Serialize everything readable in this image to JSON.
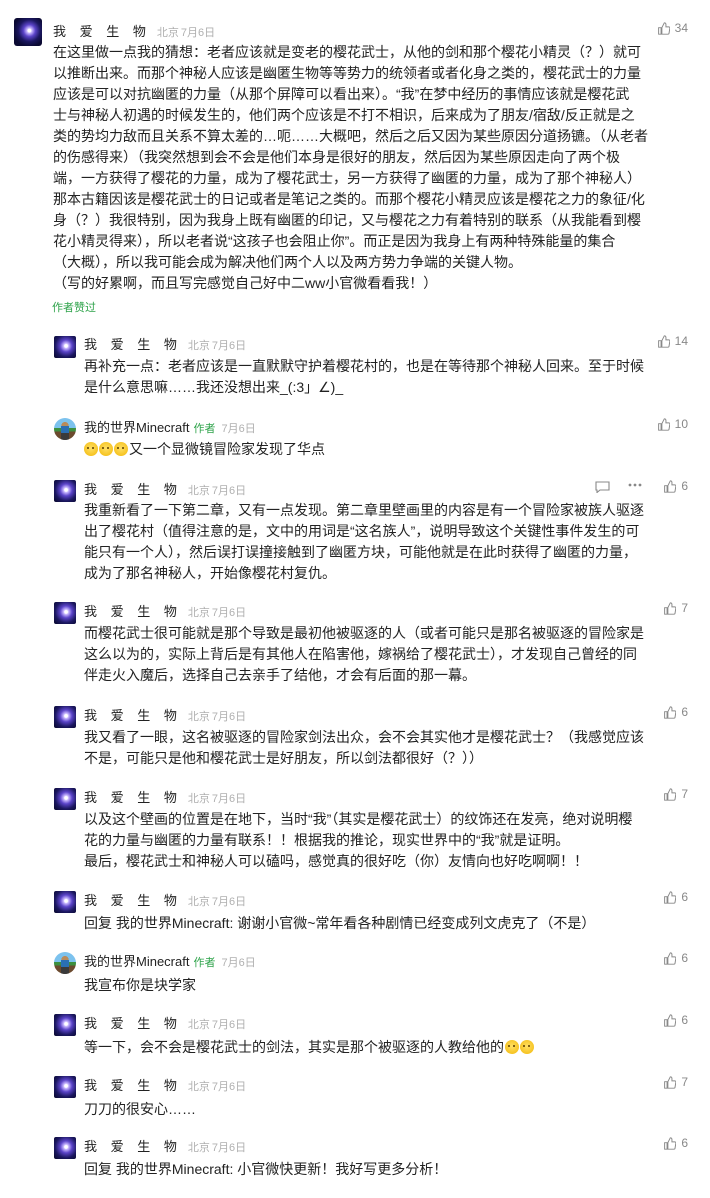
{
  "like_icon": "thumb-up-icon",
  "comments": [
    {
      "user": "我 爱 生 物",
      "location": "北京",
      "date": "7月6日",
      "likes": "34",
      "lines": [
        "在这里做一点我的猜想：老者应该就是变老的樱花武士，从他的剑和那个樱花小精灵（？）就可",
        "以推断出来。而那个神秘人应该是幽匿生物等等势力的统领者或者化身之类的，樱花武士的力量",
        "应该是可以对抗幽匿的力量（从那个屏障可以看出来）。“我”在梦中经历的事情应该就是樱花武",
        "士与神秘人初遇的时候发生的，他们两个应该是不打不相识，后来成为了朋友/宿敌/反正就是之",
        "类的势均力敌而且关系不算太差的…呃……大概吧，然后之后又因为某些原因分道扬镳。（从老者",
        "的伤感得来）（我突然想到会不会是他们本身是很好的朋友，然后因为某些原因走向了两个极",
        "端，一方获得了樱花的力量，成为了樱花武士，另一方获得了幽匿的力量，成为了那个神秘人）",
        "那本古籍因该是樱花武士的日记或者是笔记之类的。而那个樱花小精灵应该是樱花之力的象征/化",
        "身（？）我很特别，因为我身上既有幽匿的印记，又与樱花之力有着特别的联系（从我能看到樱",
        "花小精灵得来），所以老者说“这孩子也会阻止你”。而正是因为我身上有两种特殊能量的集合",
        "（大概），所以我可能会成为解决他们两个人以及两方势力争端的关键人物。",
        "（写的好累啊，而且写完感觉自己好中二ww小官微看看我！）"
      ],
      "creator_badge": "作者赞过"
    },
    {
      "user": "我 爱 生 物",
      "location": "北京",
      "date": "7月6日",
      "likes": "14",
      "lines": [
        "再补充一点：老者应该是一直默默守护着樱花村的，也是在等待那个神秘人回来。至于时候",
        "是什么意思嘛……我还没想出来_(:3」∠)_"
      ]
    },
    {
      "user": "我的世界Minecraft",
      "author_tag": "作者",
      "date": "7月6日",
      "likes": "10",
      "lines": [
        "又一个显微镜冒险家发现了华点"
      ],
      "emoji_prefix_count": 3
    },
    {
      "user": "我 爱 生 物",
      "location": "北京",
      "date": "7月6日",
      "likes": "6",
      "menu_icon": "comment-menu-icon",
      "lines": [
        "我重新看了一下第二章，又有一点发现。第二章里壁画里的内容是有一个冒险家被族人驱逐",
        "出了樱花村（值得注意的是，文中的用词是“这名族人”，说明导致这个关键性事件发生的可",
        "能只有一个人），然后误打误撞接触到了幽匿方块，可能他就是在此时获得了幽匿的力量，",
        "成为了那名神秘人，开始像樱花村复仇。"
      ]
    },
    {
      "user": "我 爱 生 物",
      "location": "北京",
      "date": "7月6日",
      "likes": "7",
      "lines": [
        "而樱花武士很可能就是那个导致是最初他被驱逐的人（或者可能只是那名被驱逐的冒险家是",
        "这么以为的，实际上背后是有其他人在陷害他，嫁祸给了樱花武士），才发现自己曾经的同",
        "伴走火入魔后，选择自己去亲手了结他，才会有后面的那一幕。"
      ]
    },
    {
      "user": "我 爱 生 物",
      "location": "北京",
      "date": "7月6日",
      "likes": "6",
      "lines": [
        "我又看了一眼，这名被驱逐的冒险家剑法出众，会不会其实他才是樱花武士？（我感觉应该",
        "不是，可能只是他和樱花武士是好朋友，所以剑法都很好（？））"
      ]
    },
    {
      "user": "我 爱 生 物",
      "location": "北京",
      "date": "7月6日",
      "likes": "7",
      "lines": [
        "以及这个壁画的位置是在地下，当时“我”（其实是樱花武士）的纹饰还在发亮，绝对说明樱",
        "花的力量与幽匿的力量有联系！！根据我的推论，现实世界中的“我”就是证明。",
        "最后，樱花武士和神秘人可以磕吗，感觉真的很好吃（你）友情向也好吃啊啊！！"
      ]
    },
    {
      "user": "我 爱 生 物",
      "location": "北京",
      "date": "7月6日",
      "likes": "6",
      "reply_to": "回复 我的世界Minecraft:",
      "lines": [
        "谢谢小官微~常年看各种剧情已经变成列文虎克了（不是）"
      ]
    },
    {
      "user": "我的世界Minecraft",
      "author_tag": "作者",
      "date": "7月6日",
      "likes": "6",
      "lines": [
        "我宣布你是块学家"
      ]
    },
    {
      "user": "我 爱 生 物",
      "location": "北京",
      "date": "7月6日",
      "likes": "6",
      "lines": [
        "等一下，会不会是樱花武士的剑法，其实是那个被驱逐的人教给他的"
      ],
      "emoji_suffix_count": 2
    },
    {
      "user": "我 爱 生 物",
      "location": "北京",
      "date": "7月6日",
      "likes": "7",
      "lines": [
        "刀刀的很安心……"
      ]
    },
    {
      "user": "我 爱 生 物",
      "location": "北京",
      "date": "7月6日",
      "likes": "6",
      "reply_to": "回复 我的世界Minecraft:",
      "lines": [
        "小官微快更新！我好写更多分析！"
      ]
    }
  ]
}
